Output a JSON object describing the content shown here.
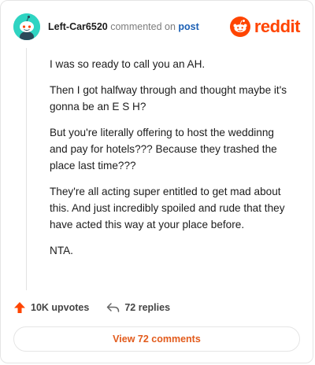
{
  "header": {
    "username": "Left-Car6520",
    "action_text": "commented on",
    "post_link": "post",
    "brand_name": "reddit"
  },
  "comment": {
    "paragraphs": [
      "I was so ready to call you an AH.",
      "Then I got halfway through and thought maybe it's gonna be an E S H?",
      "But you're literally offering to host the weddinng and pay for hotels??? Because they trashed the place last time???",
      "They're all acting super entitled to get mad about this. And just incredibly spoiled and rude that they have acted this way at your place before.",
      "NTA."
    ]
  },
  "actions": {
    "upvotes": "10K upvotes",
    "replies": "72 replies"
  },
  "footer": {
    "view_comments": "View 72 comments"
  },
  "colors": {
    "brand": "#ff4500",
    "avatar_bg": "#2fd4c2",
    "link": "#1a5fb4",
    "view_button_text": "#e25b1c"
  },
  "icons": {
    "avatar": "snoo-avatar-icon",
    "brand": "reddit-logo-icon",
    "upvote": "upvote-arrow-icon",
    "reply": "reply-arrow-icon"
  }
}
